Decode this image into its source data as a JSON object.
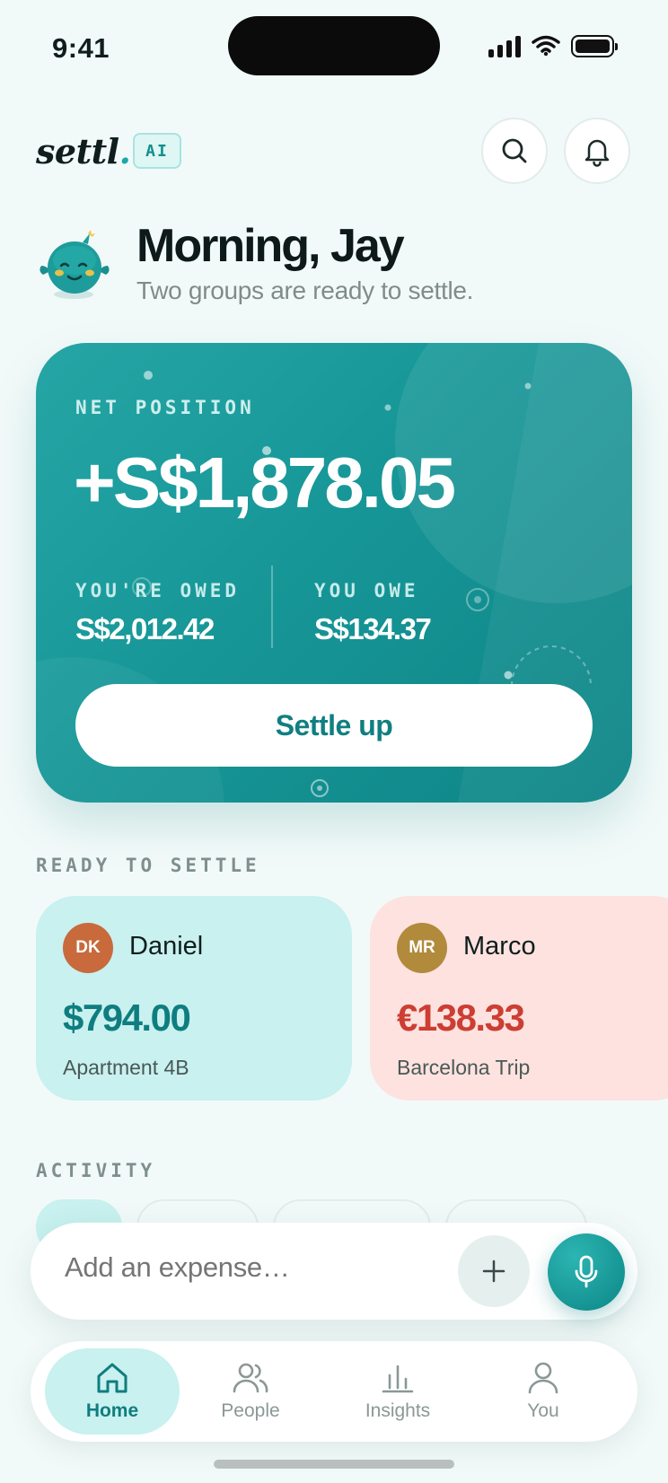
{
  "status_bar": {
    "time": "9:41"
  },
  "header": {
    "logo": "settl",
    "logo_dot": ".",
    "ai_badge": "AI"
  },
  "greeting": {
    "title": "Morning, Jay",
    "subtitle": "Two groups are ready to settle."
  },
  "net_card": {
    "label": "NET POSITION",
    "amount": "+S$1,878.05",
    "owed_label": "YOU'RE OWED",
    "owed_value": "S$2,012.42",
    "owe_label": "YOU OWE",
    "owe_value": "S$134.37",
    "settle_button": "Settle up"
  },
  "ready_section": {
    "label": "READY TO SETTLE",
    "cards": [
      {
        "initials": "DK",
        "name": "Daniel",
        "amount": "$794.00",
        "group": "Apartment 4B",
        "avatar_color": "#c86a3c",
        "amount_color": "#0f7d7f"
      },
      {
        "initials": "MR",
        "name": "Marco",
        "amount": "€138.33",
        "group": "Barcelona Trip",
        "avatar_color": "#b18a3c",
        "amount_color": "#cc3e33"
      }
    ]
  },
  "activity_section": {
    "label": "ACTIVITY"
  },
  "expense_bar": {
    "placeholder": "Add an expense…"
  },
  "nav": {
    "items": [
      {
        "label": "Home",
        "icon": "home-icon",
        "active": true
      },
      {
        "label": "People",
        "icon": "people-icon",
        "active": false
      },
      {
        "label": "Insights",
        "icon": "chart-icon",
        "active": false
      },
      {
        "label": "You",
        "icon": "user-icon",
        "active": false
      }
    ]
  },
  "colors": {
    "accent": "#1a9a9a",
    "background": "#f2faf9"
  }
}
